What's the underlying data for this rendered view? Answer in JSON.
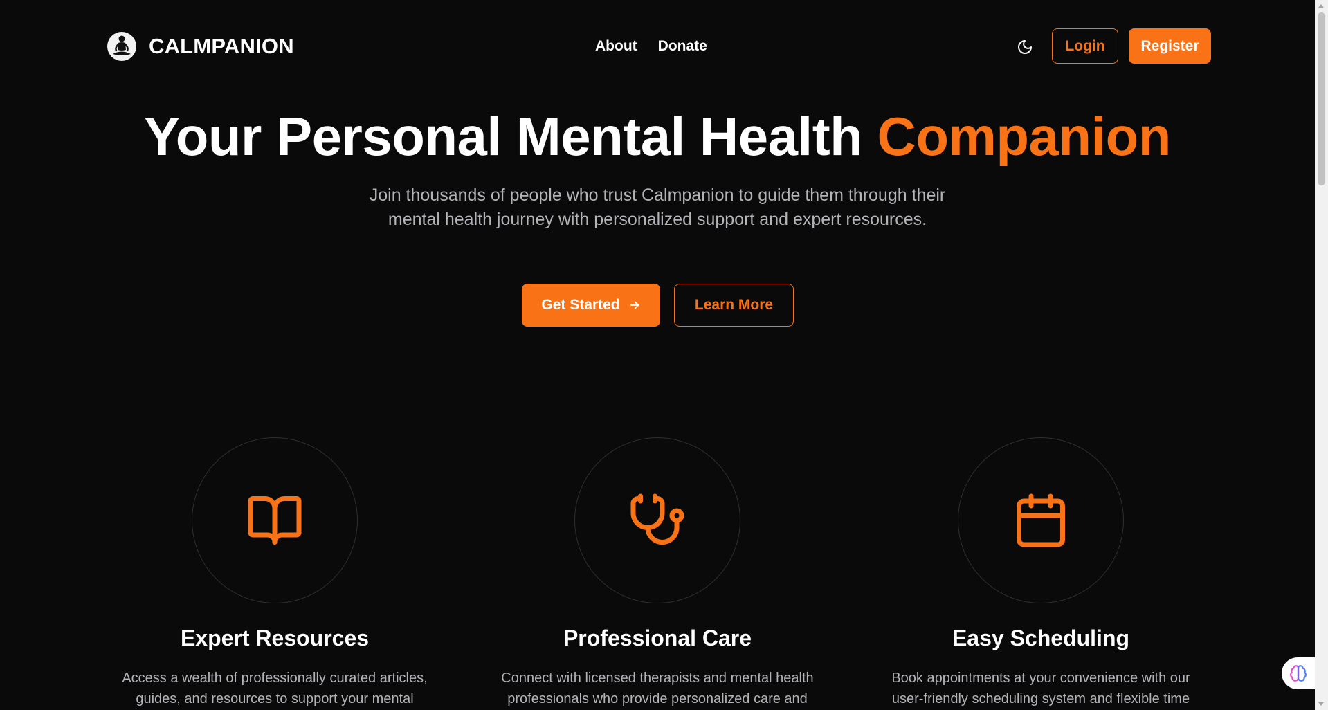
{
  "header": {
    "logo_text": "CALMPANION",
    "logo_icon": "meditation-figure-icon",
    "nav": [
      {
        "label": "About"
      },
      {
        "label": "Donate"
      }
    ],
    "theme_icon": "moon-icon",
    "login_label": "Login",
    "register_label": "Register"
  },
  "hero": {
    "title_main": "Your Personal Mental Health",
    "title_accent": "Companion",
    "subtitle": "Join thousands of people who trust Calmpanion to guide them through their mental health journey with personalized support and expert resources.",
    "primary_button": "Get Started",
    "primary_icon": "arrow-right-icon",
    "secondary_button": "Learn More"
  },
  "features": [
    {
      "icon": "book-open-icon",
      "title": "Expert Resources",
      "description": "Access a wealth of professionally curated articles, guides, and resources to support your mental"
    },
    {
      "icon": "stethoscope-icon",
      "title": "Professional Care",
      "description": "Connect with licensed therapists and mental health professionals who provide personalized care and"
    },
    {
      "icon": "calendar-icon",
      "title": "Easy Scheduling",
      "description": "Book appointments at your convenience with our user-friendly scheduling system and flexible time"
    }
  ],
  "widget": {
    "icon": "brain-icon"
  },
  "colors": {
    "background": "#0a0a0b",
    "accent": "#f97316",
    "text": "#ffffff",
    "muted_text": "#b3b3b8",
    "circle_border": "#2e2e33"
  }
}
